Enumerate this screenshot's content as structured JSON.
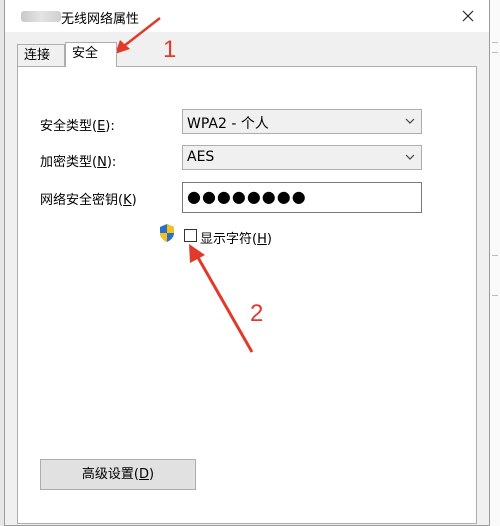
{
  "window": {
    "title": "无线网络属性",
    "close_glyph": "✕"
  },
  "tabs": [
    {
      "label": "连接",
      "active": false
    },
    {
      "label": "安全",
      "active": true
    }
  ],
  "security": {
    "type_label_prefix": "安全类型(",
    "type_label_key": "E",
    "type_label_suffix": "):",
    "type_value": "WPA2 - 个人",
    "encryption_label_prefix": "加密类型(",
    "encryption_label_key": "N",
    "encryption_label_suffix": "):",
    "encryption_value": "AES",
    "key_label_prefix": "网络安全密钥(",
    "key_label_key": "K",
    "key_label_suffix": ")",
    "key_value": "●●●●●●●●",
    "show_chars_label_prefix": "显示字符(",
    "show_chars_label_key": "H",
    "show_chars_label_suffix": ")",
    "show_chars_checked": false
  },
  "advanced_button": {
    "prefix": "高级设置(",
    "key": "D",
    "suffix": ")"
  },
  "annotations": {
    "marker_1": "1",
    "marker_2": "2",
    "color": "#e23a2a"
  }
}
